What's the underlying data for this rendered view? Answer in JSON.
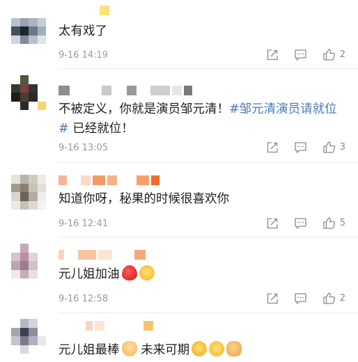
{
  "comments": [
    {
      "text": "太有戏了",
      "time": "9-16 14:19",
      "likes": "2"
    },
    {
      "text_plain": "不被定义，你就是演员邹元清！",
      "hashtag": "#邹元清演员请就位#",
      "text_after": " 已经就位！",
      "time": "9-16 13:05",
      "likes": "3"
    },
    {
      "text": "知道你呀，秘果的时候很喜欢你",
      "time": "9-16 12:41",
      "likes": "5"
    },
    {
      "text": "元儿姐加油",
      "emoji": [
        "heart-emoji",
        "starstruck-emoji"
      ],
      "time": "9-16 12:58",
      "likes": "2"
    },
    {
      "text": "元儿姐最棒",
      "text2": "未来可期",
      "emoji_after_text": [
        "victory-hand-emoji"
      ],
      "emoji_end": [
        "heart-face-emoji",
        "starstruck-emoji",
        "flexed-biceps-emoji"
      ]
    }
  ],
  "colors": {
    "hashtag": "#4a79bb",
    "meta": "#999999",
    "icon": "#8a8a8a"
  }
}
